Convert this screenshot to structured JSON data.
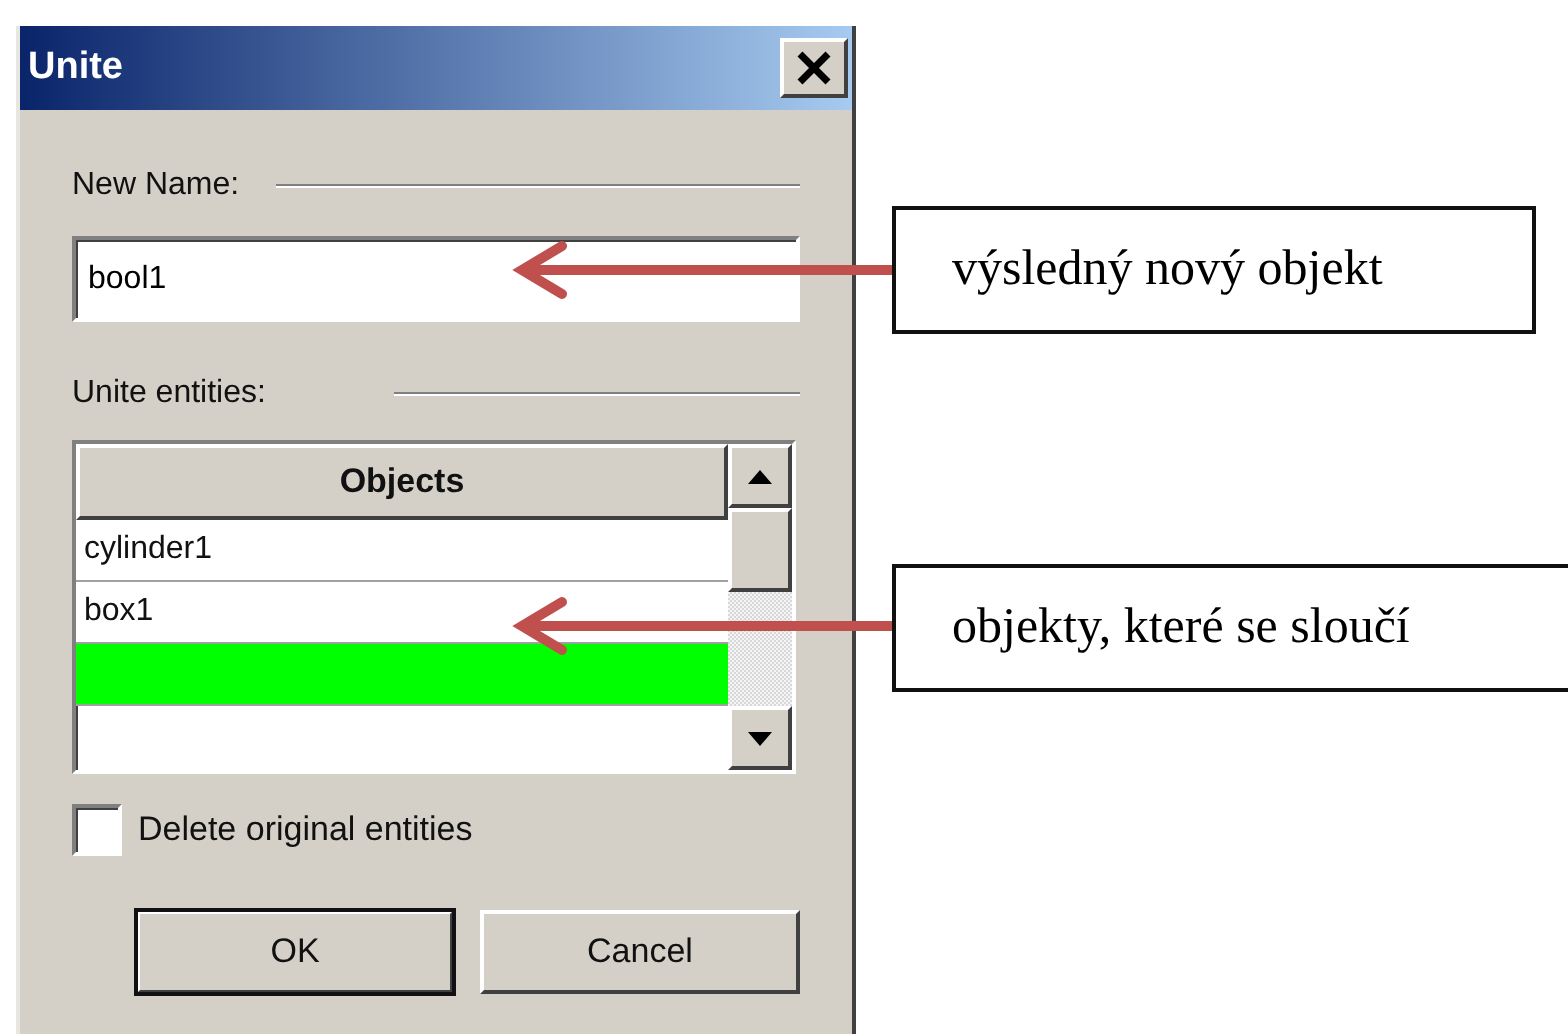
{
  "window": {
    "title": "Unite"
  },
  "new_name": {
    "label": "New Name:",
    "value": "bool1"
  },
  "entities": {
    "label": "Unite entities:",
    "table": {
      "columns": [
        "Objects"
      ],
      "rows": [
        {
          "name": "cylinder1",
          "selected": false
        },
        {
          "name": "box1",
          "selected": false
        },
        {
          "selected": true
        }
      ]
    }
  },
  "delete_original": {
    "label": "Delete original entities",
    "checked": false
  },
  "buttons": [
    {
      "label": "OK",
      "default": true
    },
    {
      "label": "Cancel",
      "default": false
    }
  ],
  "annotations": [
    {
      "text": "výsledný nový objekt"
    },
    {
      "text": "objekty, které se sloučí"
    }
  ]
}
